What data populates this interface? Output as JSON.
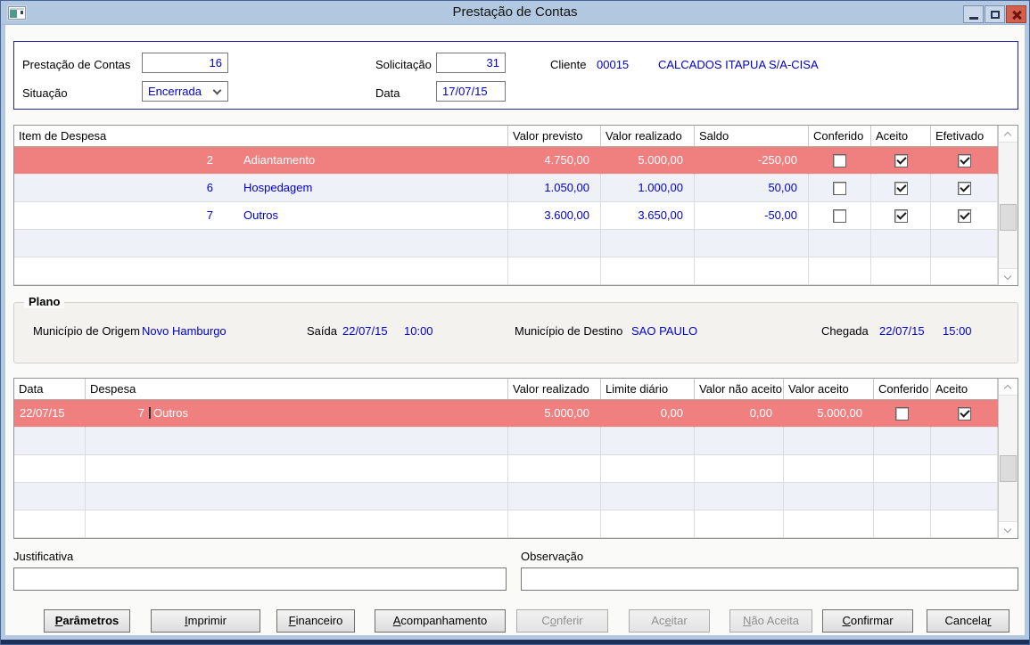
{
  "window": {
    "title": "Prestação de Contas"
  },
  "colors": {
    "titlebar": "#b2c7e0",
    "selected_row": "#f08080",
    "value_blue": "#0000cd",
    "close_button_red": "#d2604d",
    "panel_border_navy": "#2222a0"
  },
  "icons": {
    "app": "form-window-icon",
    "minimize": "minimize-icon",
    "maximize": "maximize-icon",
    "close": "close-icon",
    "situacao_dropdown": "chevron-down-icon",
    "scrollbar_up": "chevron-up-icon",
    "scrollbar_down": "chevron-down-icon",
    "edit_caret": "text-caret"
  },
  "header": {
    "prestacao_label": "Prestação de Contas",
    "prestacao_value": "16",
    "solicitacao_label": "Solicitação",
    "solicitacao_value": "31",
    "cliente_label": "Cliente",
    "cliente_code": "00015",
    "cliente_name": "CALCADOS ITAPUA S/A-CISA",
    "situacao_label": "Situação",
    "situacao_value": "Encerrada",
    "data_label": "Data",
    "data_value": "17/07/15"
  },
  "items_table": {
    "columns": [
      "Item de Despesa",
      "Valor previsto",
      "Valor realizado",
      "Saldo",
      "Conferido",
      "Aceito",
      "Efetivado"
    ],
    "rows": [
      {
        "num": "2",
        "name": "Adiantamento",
        "previsto": "4.750,00",
        "realizado": "5.000,00",
        "saldo": "-250,00",
        "conferido": false,
        "aceito": true,
        "efetivado": true,
        "selected": true
      },
      {
        "num": "6",
        "name": "Hospedagem",
        "previsto": "1.050,00",
        "realizado": "1.000,00",
        "saldo": "50,00",
        "conferido": false,
        "aceito": true,
        "efetivado": true,
        "selected": false
      },
      {
        "num": "7",
        "name": "Outros",
        "previsto": "3.600,00",
        "realizado": "3.650,00",
        "saldo": "-50,00",
        "conferido": false,
        "aceito": true,
        "efetivado": true,
        "selected": false
      }
    ]
  },
  "plano": {
    "title": "Plano",
    "origem_label": "Município de Origem",
    "origem_value": "Novo Hamburgo",
    "saida_label": "Saída",
    "saida_date": "22/07/15",
    "saida_time": "10:00",
    "destino_label": "Município de Destino",
    "destino_value": "SAO PAULO",
    "chegada_label": "Chegada",
    "chegada_date": "22/07/15",
    "chegada_time": "15:00"
  },
  "daily_table": {
    "columns": [
      "Data",
      "Despesa",
      "Valor realizado",
      "Limite diário",
      "Valor não aceito",
      "Valor aceito",
      "Conferido",
      "Aceito"
    ],
    "rows": [
      {
        "data": "22/07/15",
        "num": "7",
        "name": "Outros",
        "realizado": "5.000,00",
        "limite": "0,00",
        "nao_aceito": "0,00",
        "valor_aceito": "5.000,00",
        "conferido": false,
        "aceito": true,
        "selected": true,
        "editing": true
      }
    ]
  },
  "fields": {
    "justificativa_label": "Justificativa",
    "justificativa_value": "",
    "observacao_label": "Observação",
    "observacao_value": ""
  },
  "buttons": [
    {
      "pre": "",
      "key": "P",
      "post": "arâmetros",
      "enabled": true,
      "default": true
    },
    {
      "pre": "",
      "key": "I",
      "post": "mprimir",
      "enabled": true
    },
    {
      "pre": "",
      "key": "F",
      "post": "inanceiro",
      "enabled": true
    },
    {
      "pre": "",
      "key": "A",
      "post": "companhamento",
      "enabled": true
    },
    {
      "pre": "C",
      "key": "o",
      "post": "nferir",
      "enabled": false
    },
    {
      "pre": "Ac",
      "key": "e",
      "post": "itar",
      "enabled": false
    },
    {
      "pre": "",
      "key": "N",
      "post": "ão Aceita",
      "enabled": false
    },
    {
      "pre": "",
      "key": "C",
      "post": "onfirmar",
      "enabled": true
    },
    {
      "pre": "Cancela",
      "key": "r",
      "post": "",
      "enabled": true
    }
  ]
}
